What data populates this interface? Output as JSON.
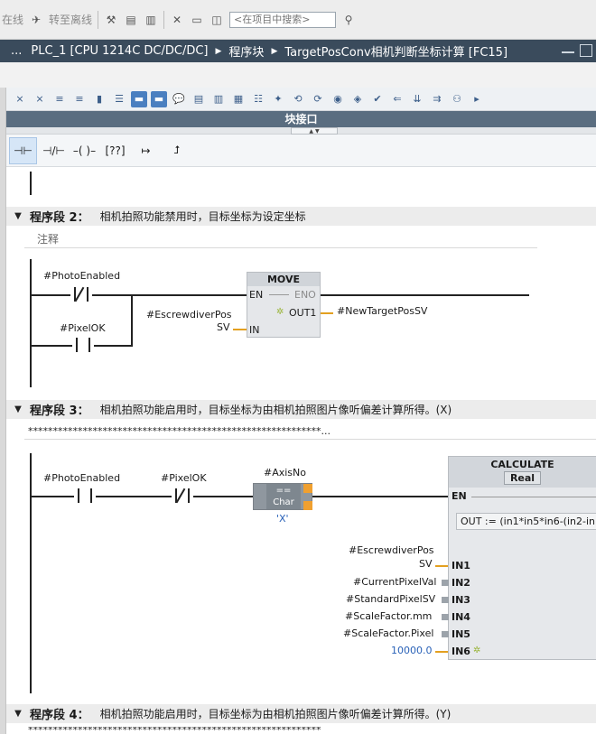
{
  "toolbar": {
    "online_label": "在线",
    "go_offline_label": "转至离线",
    "search_placeholder": "<在项目中搜索>"
  },
  "breadcrumb": {
    "lead": "...",
    "items": [
      "PLC_1 [CPU 1214C DC/DC/DC]",
      "程序块",
      "TargetPosConv相机判断坐标计算 [FC15]"
    ]
  },
  "interface_bar": {
    "label": "块接口"
  },
  "networks": [
    {
      "title": "程序段 2：",
      "description": "相机拍照功能禁用时，目标坐标为设定坐标",
      "comment": "注释",
      "contacts": {
        "photo": "#PhotoEnabled",
        "pixel": "#PixelOK"
      },
      "move": {
        "title": "MOVE",
        "en": "EN",
        "eno": "ENO",
        "in": "IN",
        "out": "OUT1",
        "in_tag_1": "#EscrewdiverPos",
        "in_tag_2": "SV",
        "out_tag": "#NewTargetPosSV"
      }
    },
    {
      "title": "程序段 3：",
      "description": "相机拍照功能启用时，目标坐标为由相机拍照图片像听偏差计算所得。(X)",
      "comment": "***********************************************************...",
      "contacts": {
        "photo": "#PhotoEnabled",
        "pixel": "#PixelOK"
      },
      "compare": {
        "tag": "#AxisNo",
        "op": "==",
        "type": "Char",
        "const": "'X'"
      },
      "calculate": {
        "title": "CALCULATE",
        "type": "Real",
        "en": "EN",
        "formula": "OUT := (in1*in5*in6-(in2-in",
        "pins": [
          "IN1",
          "IN2",
          "IN3",
          "IN4",
          "IN5",
          "IN6"
        ],
        "inputs_1a": "#EscrewdiverPos",
        "inputs_1b": "SV",
        "inputs": [
          "#CurrentPixelVal",
          "#StandardPixelSV",
          "#ScaleFactor.mm",
          "#ScaleFactor.Pixel",
          "10000.0"
        ]
      }
    },
    {
      "title": "程序段 4：",
      "description": "相机拍照功能启用时，目标坐标为由相机拍照图片像听偏差计算所得。(Y)",
      "comment": "***********************************************************"
    }
  ]
}
